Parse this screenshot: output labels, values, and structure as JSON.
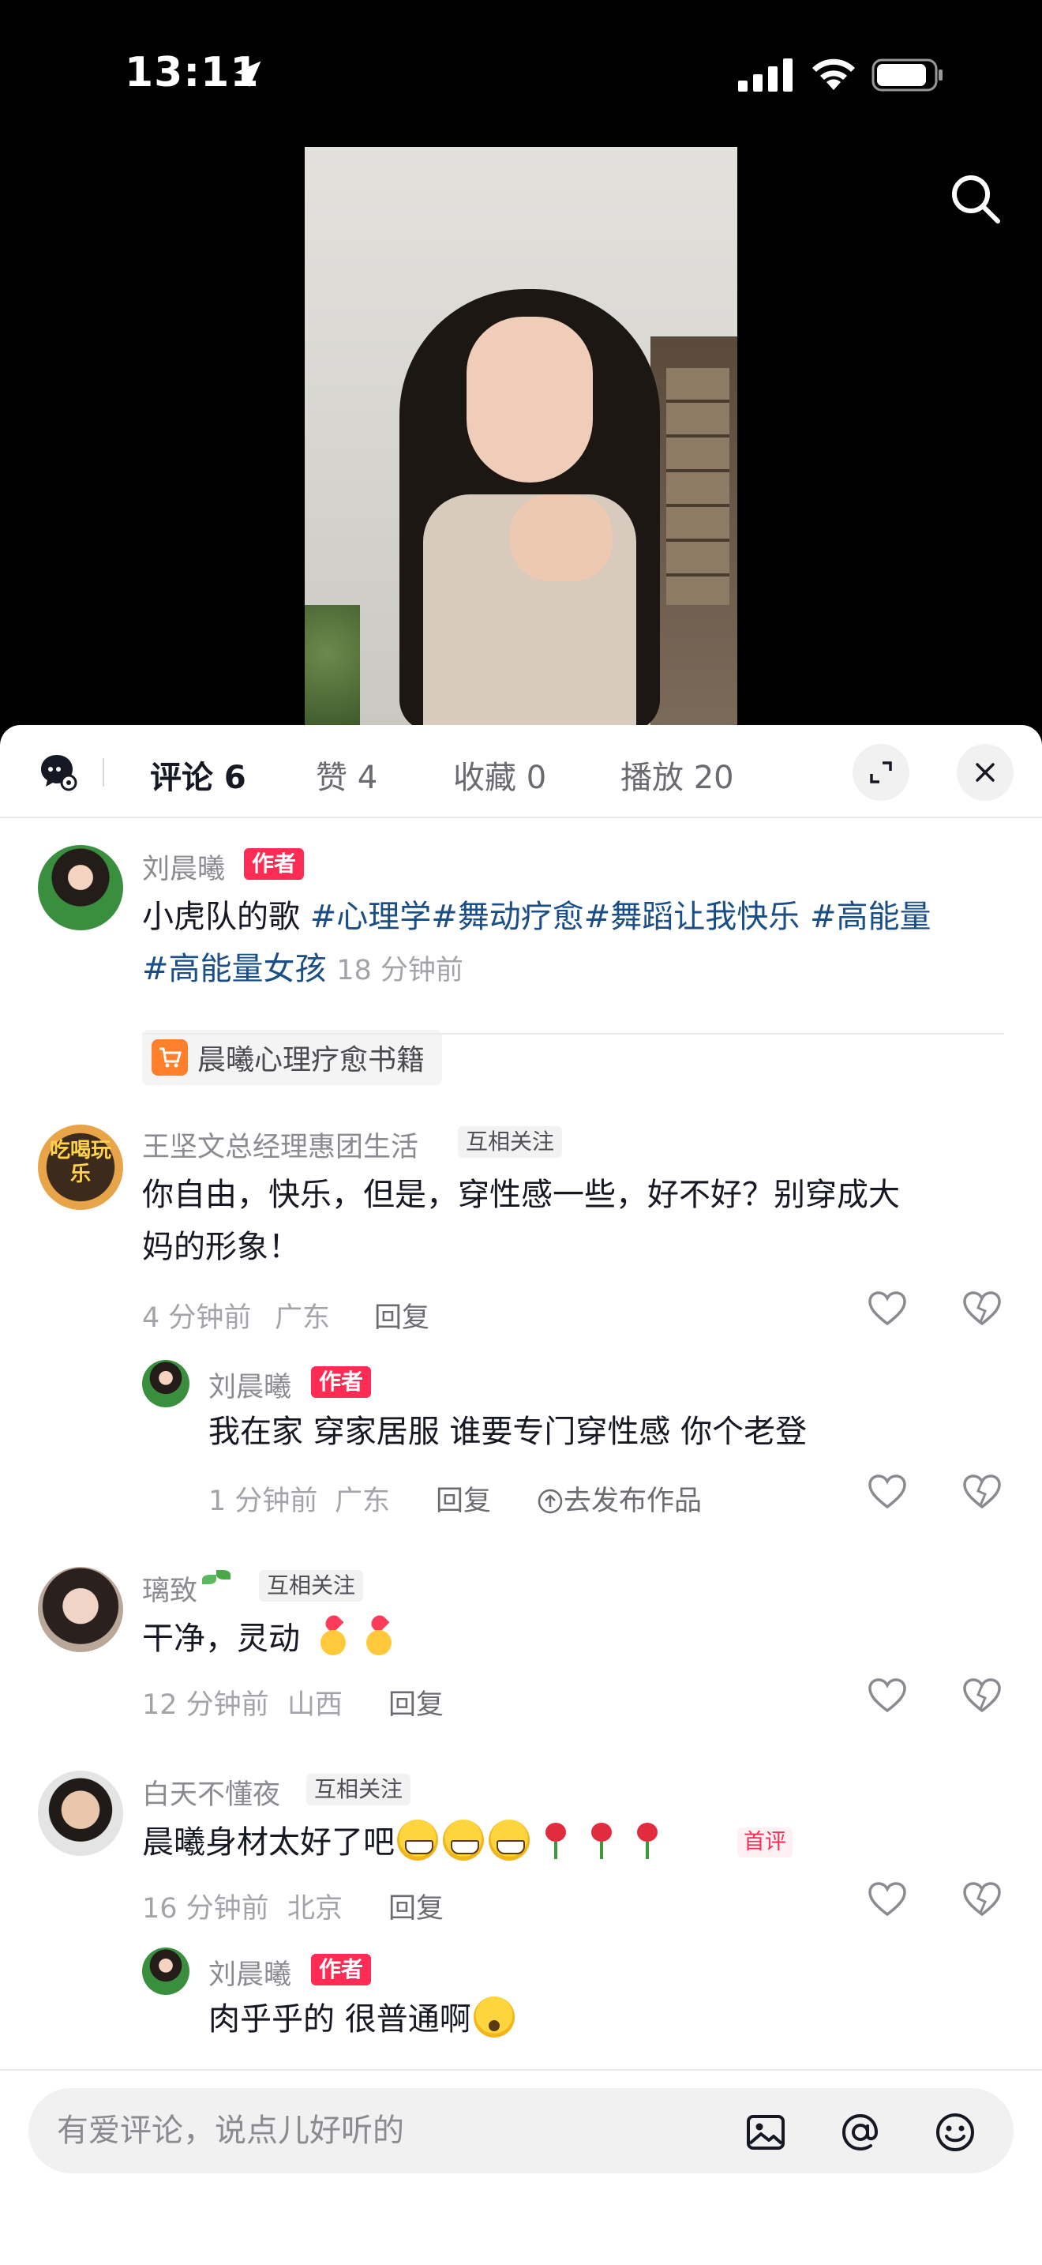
{
  "status_bar": {
    "time": "13:11"
  },
  "tabs": [
    {
      "label": "评论 6",
      "active": true
    },
    {
      "label": "赞 4",
      "active": false
    },
    {
      "label": "收藏 0",
      "active": false
    },
    {
      "label": "播放 20",
      "active": false
    }
  ],
  "author_post": {
    "username": "刘晨曦",
    "badge": "作者",
    "text_plain": "小虎队的歌 ",
    "hashtags_line1": "#心理学#舞动疗愈#舞蹈让我快乐 #高能量",
    "hashtags_line2": "#高能量女孩",
    "time": "18 分钟前",
    "shop_label": "晨曦心理疗愈书籍"
  },
  "comments": [
    {
      "username": "王坚文总经理惠团生活",
      "badge": "互相关注",
      "avatar_text": "吃喝玩乐",
      "line1": "你自由，快乐，但是，穿性感一些，好不好？别穿成大",
      "line2": "妈的形象！",
      "time": "4 分钟前",
      "location": "广东",
      "reply": "回复",
      "reply_item": {
        "username": "刘晨曦",
        "badge": "作者",
        "text": "我在家 穿家居服 谁要专门穿性感 你个老登",
        "time": "1 分钟前",
        "location": "广东",
        "reply": "回复",
        "publish": "去发布作品"
      }
    },
    {
      "username": "璃致",
      "badge": "互相关注",
      "text": "干净，灵动 ",
      "time": "12 分钟前",
      "location": "山西",
      "reply": "回复"
    },
    {
      "username": "白天不懂夜",
      "badge": "互相关注",
      "text": "晨曦身材太好了吧",
      "first_badge": "首评",
      "time": "16 分钟前",
      "location": "北京",
      "reply": "回复",
      "reply_item": {
        "username": "刘晨曦",
        "badge": "作者",
        "text": "肉乎乎的 很普通啊"
      }
    }
  ],
  "input": {
    "placeholder": "有爱评论，说点儿好听的",
    "value": ""
  },
  "colors": {
    "accent": "#fe2c55",
    "hashtag": "#1a4e86",
    "muted": "#8a8b91"
  },
  "icons": [
    "location-arrow-icon",
    "signal-icon",
    "wifi-icon",
    "battery-icon",
    "search-icon",
    "chat-settings-icon",
    "expand-icon",
    "close-icon",
    "cart-icon",
    "heart-icon",
    "dislike-icon",
    "image-icon",
    "at-icon",
    "emoji-icon"
  ]
}
